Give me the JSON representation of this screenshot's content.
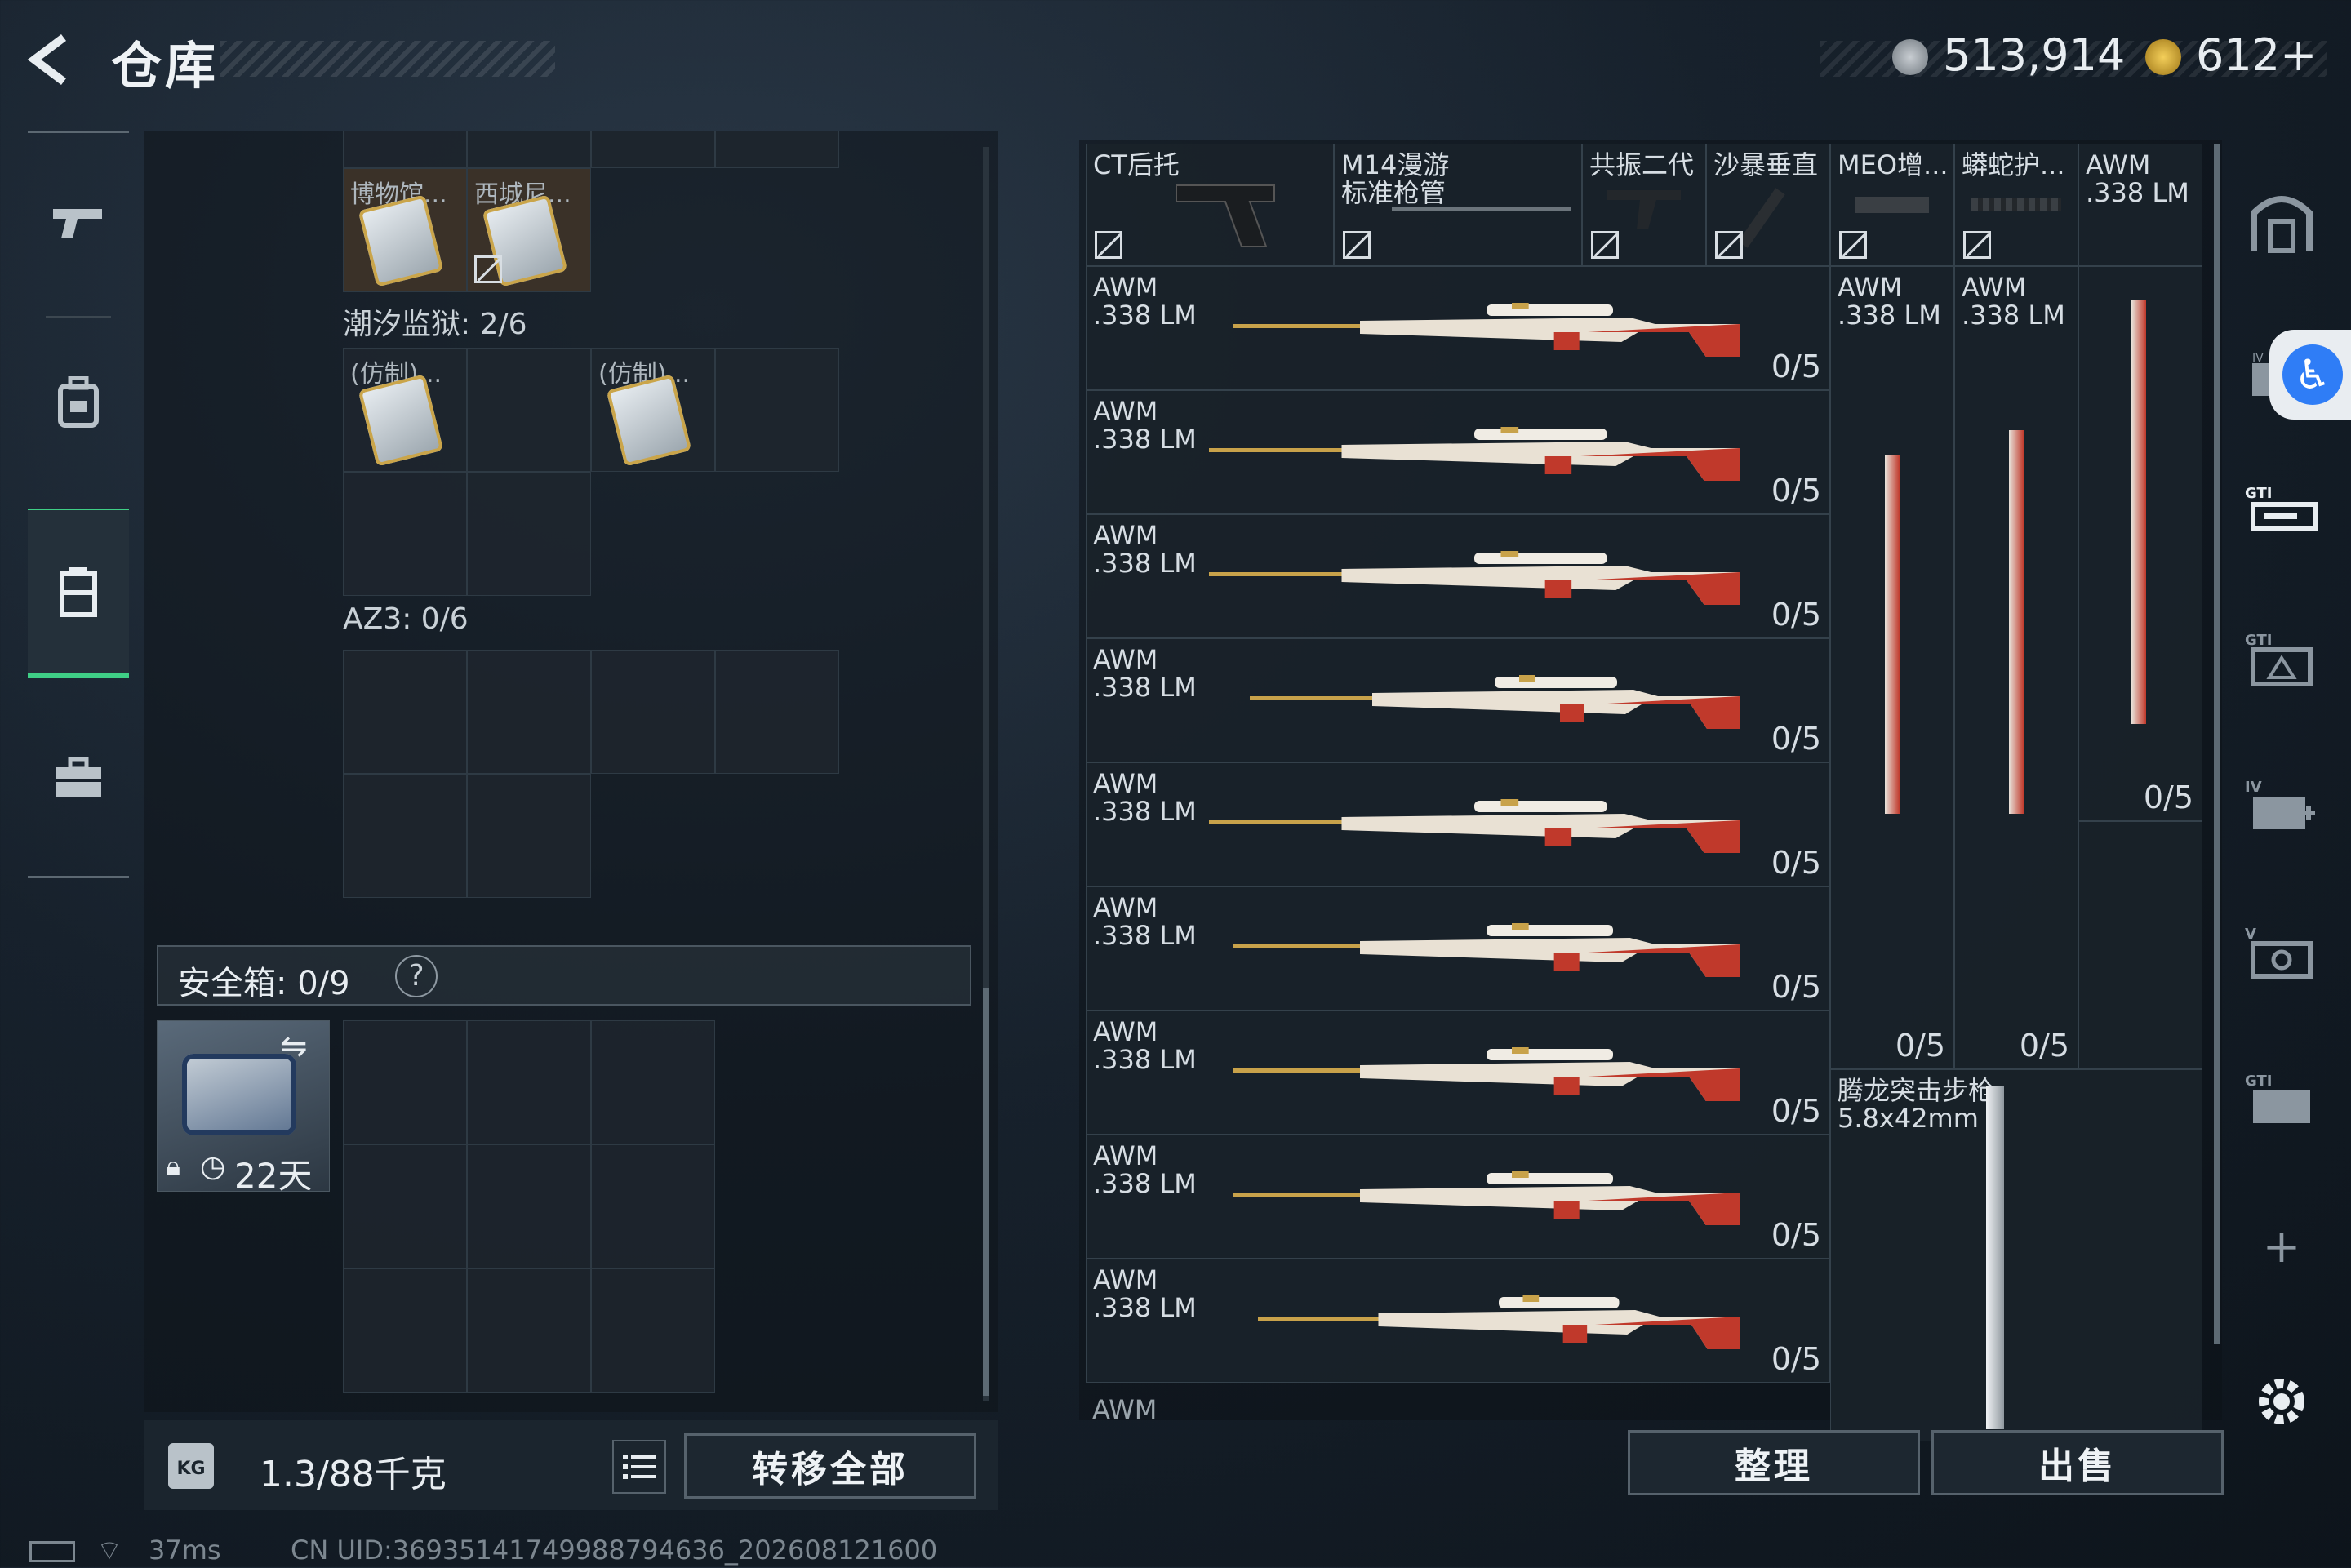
{
  "header": {
    "back_icon": "arrow-left-icon",
    "title": "仓库",
    "currency1": "513,914",
    "currency2": "612+"
  },
  "left_rail": {
    "items": [
      "pistol-icon",
      "backpack-icon",
      "vest-icon",
      "briefcase-icon"
    ]
  },
  "storage": {
    "top_cells": [
      {
        "label": "博物馆..."
      },
      {
        "label": "西城尼..."
      }
    ],
    "section1": "潮汐监狱: 2/6",
    "section1_cells": [
      {
        "label": "(仿制)..."
      },
      {
        "label": "(仿制)..."
      }
    ],
    "section2": "AZ3: 0/6",
    "safe_label": "安全箱: 0/9",
    "safe_help": "?",
    "safe_item_days": "22天",
    "weight": "1.3/88千克",
    "transfer_all": "转移全部"
  },
  "weapons": {
    "header": [
      {
        "name": "CT后托"
      },
      {
        "name": "M14漫游\n标准枪管"
      },
      {
        "name": "共振二代"
      },
      {
        "name": "沙暴垂直"
      },
      {
        "name": "MEO增..."
      },
      {
        "name": "蟒蛇护..."
      },
      {
        "name": "AWM\n.338 LM"
      }
    ],
    "awm_label": "AWM\n.338 LM",
    "count": "0/5",
    "rows": [
      "0/5",
      "0/5",
      "0/5",
      "0/5",
      "0/5",
      "0/5",
      "0/5",
      "0/5",
      "0/5"
    ],
    "last_row_label": "AWM",
    "meo_label": "AWM\n.338 LM",
    "meo_count": "0/5",
    "snake_label": "AWM\n.338 LM",
    "snake_count": "0/5",
    "col7_count": "0/5",
    "assault_label": "腾龙突击步枪\n5.8x42mm",
    "organize": "整理",
    "sell": "出售"
  },
  "status_bar": {
    "ping": "37ms",
    "uid": "CN UID:36935141749988794636_202608121600"
  },
  "colors": {
    "accent_green": "#3fcf86",
    "weapon_red": "#c0392b",
    "weapon_gold": "#c8a24a"
  }
}
